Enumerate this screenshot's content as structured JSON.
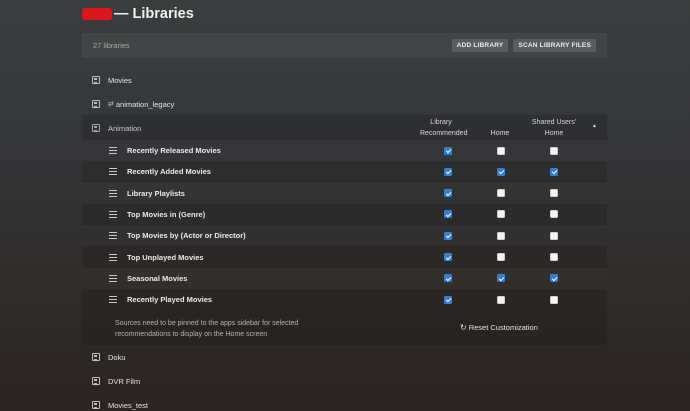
{
  "header": {
    "title": "— Libraries"
  },
  "summary": {
    "count": "27 libraries",
    "add_library": "ADD LIBRARY",
    "scan_library_files": "SCAN LIBRARY FILES"
  },
  "libraries_before": [
    {
      "name": "Movies",
      "shared": false
    },
    {
      "name": "animation_legacy",
      "shared": true
    },
    {
      "name": "Animation",
      "shared": false
    }
  ],
  "columns": {
    "library_recommended": "Library Recommended",
    "home": "Home",
    "shared_users_home": "Shared Users' Home"
  },
  "recommendations": [
    {
      "label": "Recently Released Movies",
      "library": true,
      "home": false,
      "shared": false
    },
    {
      "label": "Recently Added Movies",
      "library": true,
      "home": true,
      "shared": true
    },
    {
      "label": "Library Playlists",
      "library": true,
      "home": false,
      "shared": false
    },
    {
      "label": "Top Movies in (Genre)",
      "library": true,
      "home": false,
      "shared": false
    },
    {
      "label": "Top Movies by (Actor or Director)",
      "library": true,
      "home": false,
      "shared": false
    },
    {
      "label": "Top Unplayed Movies",
      "library": true,
      "home": false,
      "shared": false
    },
    {
      "label": "Seasonal Movies",
      "library": true,
      "home": true,
      "shared": true
    },
    {
      "label": "Recently Played Movies",
      "library": true,
      "home": false,
      "shared": false
    }
  ],
  "footer": {
    "note": "Sources need to be pinned to the apps sidebar for selected recommendations to display on the Home screen",
    "reset": "Reset Customization"
  },
  "libraries_after": [
    {
      "name": "Doku"
    },
    {
      "name": "DVR Film"
    },
    {
      "name": "Movies_test"
    }
  ],
  "colors": {
    "accent_checked": "#2f7fd8",
    "redaction": "#e0141b"
  }
}
